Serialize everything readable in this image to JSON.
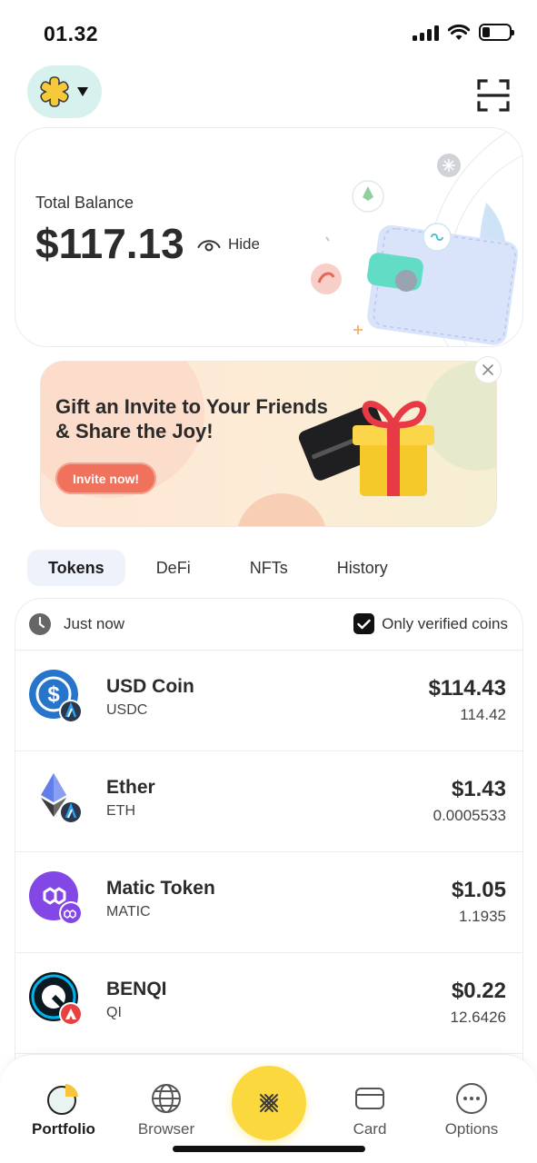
{
  "status_bar": {
    "time": "01.32",
    "battery_level": 0.28
  },
  "header": {
    "wallet_switch_icon": "asterisk-logo-icon",
    "scan_icon": "scan-icon"
  },
  "balance": {
    "label": "Total Balance",
    "value": "$117.13",
    "hide_label": "Hide"
  },
  "promo": {
    "title": "Gift an Invite to Your Friends & Share the Joy!",
    "cta": "Invite now!"
  },
  "tabs": [
    {
      "label": "Tokens",
      "active": true
    },
    {
      "label": "DeFi",
      "active": false
    },
    {
      "label": "NFTs",
      "active": false
    },
    {
      "label": "History",
      "active": false
    }
  ],
  "token_list": {
    "last_update": "Just now",
    "verified_label": "Only verified coins",
    "verified_checked": true,
    "tokens": [
      {
        "name": "USD Coin",
        "symbol": "USDC",
        "value": "$114.43",
        "amount": "114.42",
        "icon": "usdc-icon",
        "network_icon": "arbitrum-icon",
        "color": "#2775ca"
      },
      {
        "name": "Ether",
        "symbol": "ETH",
        "value": "$1.43",
        "amount": "0.0005533",
        "icon": "ethereum-icon",
        "network_icon": "arbitrum-icon",
        "color": "#627eea"
      },
      {
        "name": "Matic Token",
        "symbol": "MATIC",
        "value": "$1.05",
        "amount": "1.1935",
        "icon": "polygon-icon",
        "network_icon": "polygon-icon",
        "color": "#8247e5"
      },
      {
        "name": "BENQI",
        "symbol": "QI",
        "value": "$0.22",
        "amount": "12.6426",
        "icon": "benqi-icon",
        "network_icon": "avalanche-icon",
        "color": "#00b3ec"
      }
    ]
  },
  "bottom_nav": {
    "items": [
      {
        "label": "Portfolio",
        "icon": "portfolio-pie-icon",
        "active": true
      },
      {
        "label": "Browser",
        "icon": "globe-icon",
        "active": false
      },
      {
        "label": "Card",
        "icon": "card-icon",
        "active": false
      },
      {
        "label": "Options",
        "icon": "more-icon",
        "active": false
      }
    ],
    "center_icon": "swap-icon",
    "center_color": "#fbd93e"
  }
}
